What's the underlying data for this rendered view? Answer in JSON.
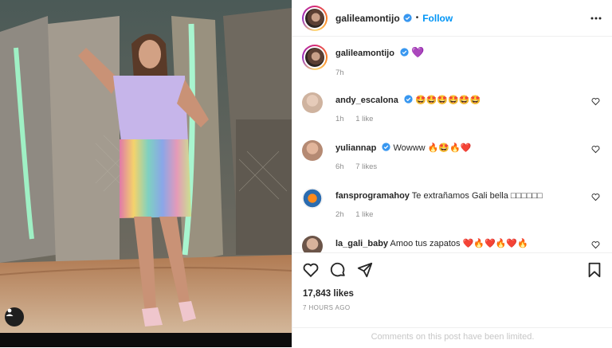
{
  "post": {
    "author": "galileamontijo",
    "follow_label": "Follow",
    "separator": "•"
  },
  "caption": {
    "username": "galileamontijo",
    "text": "💜",
    "time": "7h"
  },
  "comments": [
    {
      "username": "andy_escalona",
      "text": "🤩🤩🤩🤩🤩🤩",
      "time": "1h",
      "likes": "1 like"
    },
    {
      "username": "yuliannap",
      "text": "Wowww 🔥🤩🔥❤️",
      "time": "6h",
      "likes": "7 likes"
    },
    {
      "username": "fansprogramahoy",
      "text": "Te extrañamos Gali bella □□□□□□",
      "time": "2h",
      "likes": "1 like"
    },
    {
      "username": "la_gali_baby",
      "text": "Amoo tus zapatos ❤️🔥❤️🔥❤️🔥",
      "time": "",
      "likes": ""
    }
  ],
  "stats": {
    "likes": "17,843 likes",
    "time_ago": "7 HOURS AGO"
  },
  "footer": {
    "limited_notice": "Comments on this post have been limited."
  },
  "icons": [
    "more-icon",
    "heart-icon",
    "comment-icon",
    "share-icon",
    "bookmark-icon",
    "user-tag-icon",
    "verified-icon"
  ],
  "colors": {
    "follow": "#0095f6",
    "verified": "#3897f0",
    "muted": "#8e8e8e"
  }
}
